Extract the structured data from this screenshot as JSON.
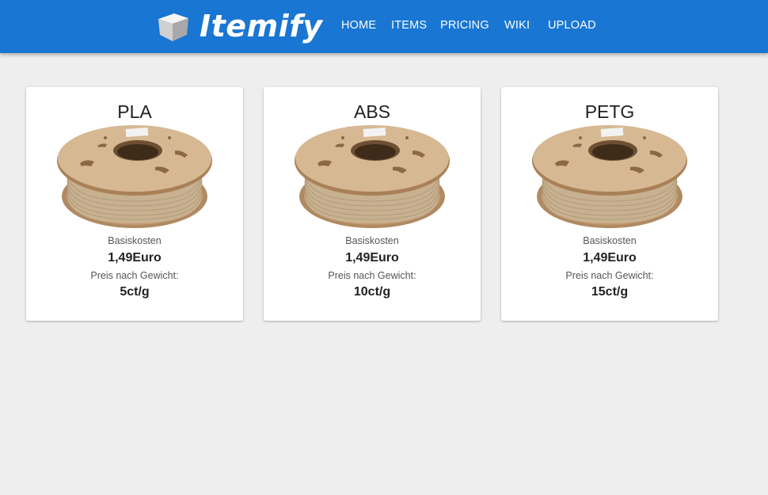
{
  "header": {
    "brand": "Itemify",
    "nav": [
      {
        "label": "HOME"
      },
      {
        "label": "ITEMS"
      },
      {
        "label": "PRICING"
      },
      {
        "label": "WIKI"
      },
      {
        "label": "UPLOAD"
      }
    ],
    "background_color": "#1976d2"
  },
  "cards": [
    {
      "title": "PLA",
      "image_icon": "filament-spool-image",
      "base_cost_label": "Basiskosten",
      "base_cost_value": "1,49Euro",
      "weight_price_label": "Preis nach Gewicht:",
      "weight_price_value": "5ct/g"
    },
    {
      "title": "ABS",
      "image_icon": "filament-spool-image",
      "base_cost_label": "Basiskosten",
      "base_cost_value": "1,49Euro",
      "weight_price_label": "Preis nach Gewicht:",
      "weight_price_value": "10ct/g"
    },
    {
      "title": "PETG",
      "image_icon": "filament-spool-image",
      "base_cost_label": "Basiskosten",
      "base_cost_value": "1,49Euro",
      "weight_price_label": "Preis nach Gewicht:",
      "weight_price_value": "15ct/g"
    }
  ]
}
